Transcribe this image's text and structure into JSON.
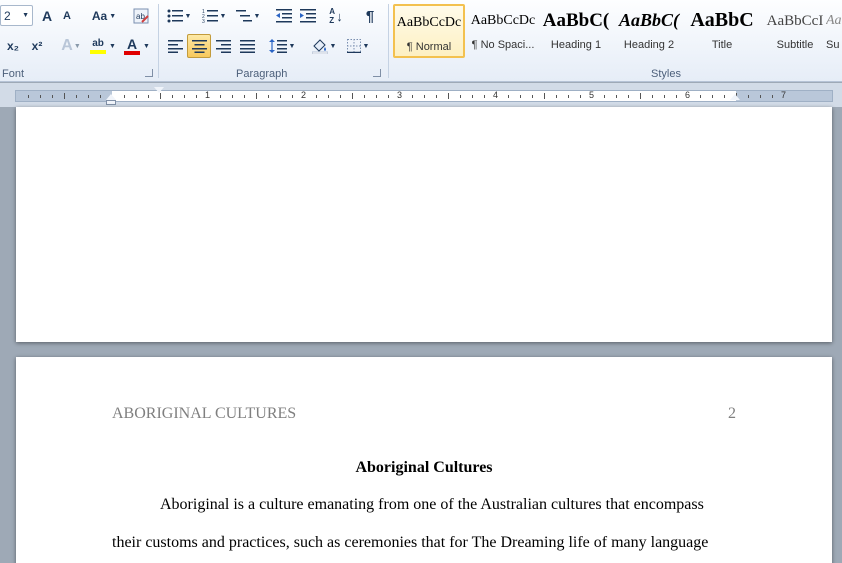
{
  "ribbon": {
    "font": {
      "size_value": "2",
      "grow_label": "A",
      "shrink_label": "A",
      "change_case_label": "Aa",
      "subscript_label": "x₂",
      "superscript_label": "x²",
      "highlight_label": "ab",
      "font_color_label": "A",
      "group_label": "Font",
      "highlight_color": "#ffff00",
      "font_color": "#e00000"
    },
    "paragraph": {
      "group_label": "Paragraph",
      "pilcrow": "¶",
      "sort_label": "A Z"
    },
    "styles": {
      "group_label": "Styles",
      "items": [
        {
          "sample": "AaBbCcDc",
          "name": "¶ Normal"
        },
        {
          "sample": "AaBbCcDc",
          "name": "¶ No Spaci..."
        },
        {
          "sample": "AaBbC(",
          "name": "Heading 1"
        },
        {
          "sample": "AaBbC(",
          "name": "Heading 2"
        },
        {
          "sample": "AaBbC",
          "name": "Title"
        },
        {
          "sample": "AaBbCcI",
          "name": "Subtitle"
        },
        {
          "sample": "Aa",
          "name": "Su"
        }
      ]
    }
  },
  "ruler": {
    "numbers": [
      "1",
      "2",
      "3",
      "4",
      "5",
      "6",
      "7"
    ]
  },
  "document": {
    "header_title": "ABORIGINAL CULTURES",
    "page_number": "2",
    "title": "Aboriginal Cultures",
    "line1": "Aboriginal is a culture emanating from one of the Australian cultures that encompass",
    "line2": "their customs and practices, such as ceremonies that for The Dreaming life of many language"
  }
}
